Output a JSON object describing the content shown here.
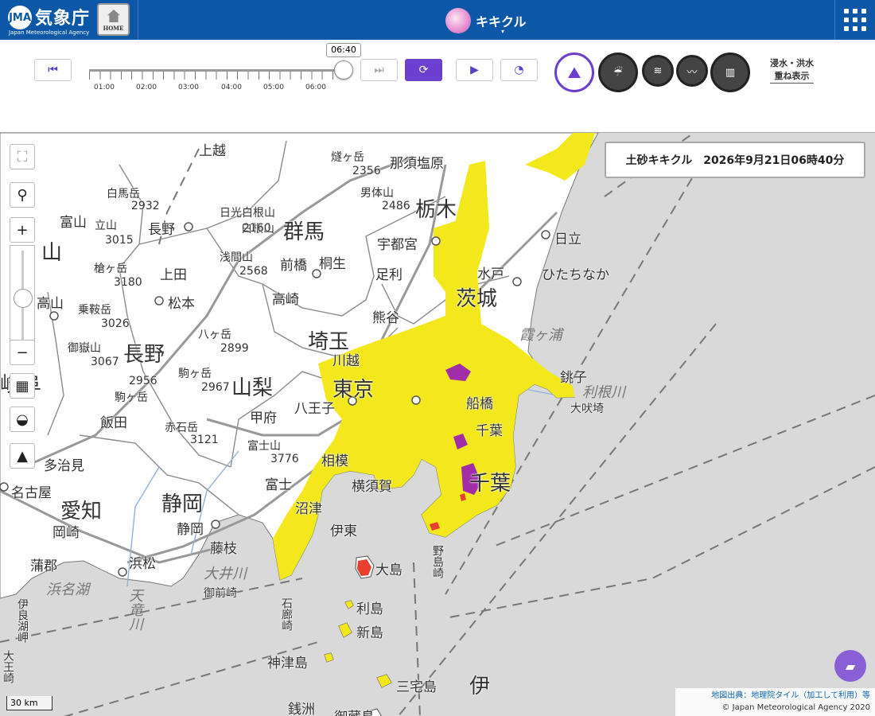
{
  "header": {
    "logo_mark": "JMA",
    "logo_title": "気象庁",
    "logo_subtitle": "Japan Meteorological Agency",
    "home_label": "HOME",
    "app_title": "キキクル",
    "caret": "▾"
  },
  "controls": {
    "current_time": "06:40",
    "timeline_labels": [
      "01:00",
      "02:00",
      "03:00",
      "04:00",
      "05:00",
      "06:00"
    ],
    "first_icon": "⏮",
    "last_icon": "⏭",
    "refresh_icon": "⟳",
    "play_icon": "▶",
    "speed_icon": "◔",
    "layer_icons": [
      "kikikuru-landslide-icon",
      "heavy-rain-icon",
      "flood-icon",
      "river-icon",
      "map-icon"
    ],
    "overlay_label_line1": "浸水・洪水",
    "overlay_label_line2": "重ね表示"
  },
  "map": {
    "info_title": "土砂キキクル　2026年9月21日06時40分",
    "scale": "30 km",
    "attribution_link": "地図出典：地理院タイル（加工して利用）等",
    "attribution_copy": "© Japan Meteorological Agency 2020",
    "tools": {
      "fullscreen": "⛶",
      "locate": "⚲",
      "zoom_in": "+",
      "zoom_out": "−",
      "basemap": "▦",
      "water": "◒",
      "terrain": "▲"
    },
    "warning_colors": {
      "caution": "#f2e81b",
      "warning": "#e83f2f",
      "danger": "#a12ea8"
    },
    "places": [
      {
        "name": "上越",
        "cls": "p-mid"
      },
      {
        "name": "燧ヶ岳",
        "cls": "p-sm"
      },
      {
        "name": "2356",
        "cls": "p-sm"
      },
      {
        "name": "那須塩原",
        "cls": "p-mid"
      },
      {
        "name": "白馬岳",
        "cls": "p-sm"
      },
      {
        "name": "2932",
        "cls": "p-sm"
      },
      {
        "name": "日光白根山",
        "cls": "p-sm"
      },
      {
        "name": "男体山",
        "cls": "p-sm"
      },
      {
        "name": "2486",
        "cls": "p-sm"
      },
      {
        "name": "栃木",
        "cls": "p-big"
      },
      {
        "name": "富山",
        "cls": "p-mid"
      },
      {
        "name": "立山",
        "cls": "p-sm"
      },
      {
        "name": "3015",
        "cls": "p-sm"
      },
      {
        "name": "長野",
        "cls": "p-mid"
      },
      {
        "name": "白根山",
        "cls": "p-sm"
      },
      {
        "name": "2160",
        "cls": "p-sm"
      },
      {
        "name": "群馬",
        "cls": "p-big"
      },
      {
        "name": "宇都宮",
        "cls": "p-mid"
      },
      {
        "name": "日立",
        "cls": "p-mid"
      },
      {
        "name": "山",
        "cls": "p-big"
      },
      {
        "name": "槍ヶ岳",
        "cls": "p-sm"
      },
      {
        "name": "3180",
        "cls": "p-sm"
      },
      {
        "name": "上田",
        "cls": "p-mid"
      },
      {
        "name": "浅間山",
        "cls": "p-sm"
      },
      {
        "name": "2568",
        "cls": "p-sm"
      },
      {
        "name": "前橋",
        "cls": "p-mid"
      },
      {
        "name": "桐生",
        "cls": "p-mid"
      },
      {
        "name": "足利",
        "cls": "p-mid"
      },
      {
        "name": "水戸",
        "cls": "p-mid"
      },
      {
        "name": "ひたちなか",
        "cls": "p-mid"
      },
      {
        "name": "高山",
        "cls": "p-mid"
      },
      {
        "name": "乗鞍岳",
        "cls": "p-sm"
      },
      {
        "name": "3026",
        "cls": "p-sm"
      },
      {
        "name": "松本",
        "cls": "p-mid"
      },
      {
        "name": "高崎",
        "cls": "p-mid"
      },
      {
        "name": "茨城",
        "cls": "p-big"
      },
      {
        "name": "熊谷",
        "cls": "p-mid"
      },
      {
        "name": "霞ヶ浦",
        "cls": "p-ital"
      },
      {
        "name": "御嶽山",
        "cls": "p-sm"
      },
      {
        "name": "3067",
        "cls": "p-sm"
      },
      {
        "name": "長野",
        "cls": "p-big"
      },
      {
        "name": "八ヶ岳",
        "cls": "p-sm"
      },
      {
        "name": "2899",
        "cls": "p-sm"
      },
      {
        "name": "埼玉",
        "cls": "p-big"
      },
      {
        "name": "川越",
        "cls": "p-mid"
      },
      {
        "name": "2956",
        "cls": "p-sm"
      },
      {
        "name": "駒ヶ岳",
        "cls": "p-sm"
      },
      {
        "name": "2967",
        "cls": "p-sm"
      },
      {
        "name": "山梨",
        "cls": "p-big"
      },
      {
        "name": "東京",
        "cls": "p-big"
      },
      {
        "name": "銚子",
        "cls": "p-mid"
      },
      {
        "name": "利根川",
        "cls": "p-ital"
      },
      {
        "name": "岐阜",
        "cls": "p-big"
      },
      {
        "name": "駒ヶ岳",
        "cls": "p-sm"
      },
      {
        "name": "甲府",
        "cls": "p-mid"
      },
      {
        "name": "八王子",
        "cls": "p-mid"
      },
      {
        "name": "船橋",
        "cls": "p-mid"
      },
      {
        "name": "千葉",
        "cls": "p-mid"
      },
      {
        "name": "飯田",
        "cls": "p-mid"
      },
      {
        "name": "赤石岳",
        "cls": "p-sm"
      },
      {
        "name": "3121",
        "cls": "p-sm"
      },
      {
        "name": "富士山",
        "cls": "p-sm"
      },
      {
        "name": "3776",
        "cls": "p-sm"
      },
      {
        "name": "相模",
        "cls": "p-mid"
      },
      {
        "name": "大吠埼",
        "cls": "p-sm"
      },
      {
        "name": "多治見",
        "cls": "p-mid"
      },
      {
        "name": "名古屋",
        "cls": "p-mid"
      },
      {
        "name": "愛知",
        "cls": "p-big"
      },
      {
        "name": "静岡",
        "cls": "p-big"
      },
      {
        "name": "富士",
        "cls": "p-mid"
      },
      {
        "name": "横須賀",
        "cls": "p-mid"
      },
      {
        "name": "千葉",
        "cls": "p-big"
      },
      {
        "name": "岡崎",
        "cls": "p-mid"
      },
      {
        "name": "沼津",
        "cls": "p-mid"
      },
      {
        "name": "静岡",
        "cls": "p-mid"
      },
      {
        "name": "伊東",
        "cls": "p-mid"
      },
      {
        "name": "蒲郡",
        "cls": "p-mid"
      },
      {
        "name": "浜松",
        "cls": "p-mid"
      },
      {
        "name": "藤枝",
        "cls": "p-mid"
      },
      {
        "name": "大島",
        "cls": "p-mid"
      },
      {
        "name": "野島崎",
        "cls": "p-sm"
      },
      {
        "name": "浜名湖",
        "cls": "p-ital"
      },
      {
        "name": "大井川",
        "cls": "p-ital"
      },
      {
        "name": "御前崎",
        "cls": "p-sm"
      },
      {
        "name": "天竜川",
        "cls": "p-ital"
      },
      {
        "name": "伊良湖岬",
        "cls": "p-sm"
      },
      {
        "name": "石廊崎",
        "cls": "p-sm"
      },
      {
        "name": "利島",
        "cls": "p-mid"
      },
      {
        "name": "新島",
        "cls": "p-mid"
      },
      {
        "name": "神津島",
        "cls": "p-mid"
      },
      {
        "name": "三宅島",
        "cls": "p-mid"
      },
      {
        "name": "伊",
        "cls": "p-big"
      },
      {
        "name": "大王崎",
        "cls": "p-sm"
      },
      {
        "name": "銭洲",
        "cls": "p-mid"
      },
      {
        "name": "御蔵島",
        "cls": "p-mid"
      }
    ]
  }
}
